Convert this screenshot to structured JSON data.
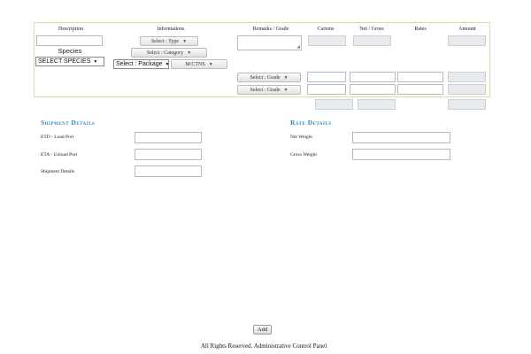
{
  "items_table": {
    "headers": {
      "description": "Description",
      "informations": "Informations",
      "remarks": "Remarks / Grade",
      "cartons": "Cartons",
      "net_gross": "Net / Gross",
      "rates": "Rates",
      "amount": "Amount"
    },
    "species_label": "Species",
    "species_select": "SELECT SPECIES",
    "type_select": "Select : Type",
    "category_select": "Select : Category",
    "package_select": "Select : Package",
    "unit_select": "M/CTNS",
    "grade_selects": [
      "Select : Grade",
      "Select : Grade"
    ]
  },
  "shipment_details": {
    "title": "Shipment Details",
    "fields": {
      "etd": "ETD - Load Port",
      "eta": "ETA - Unload Port",
      "details": "Shipment Details"
    }
  },
  "rate_details": {
    "title": "Rate Details",
    "fields": {
      "net_weight": "Net Weight",
      "gross_weight": "Gross Weight"
    }
  },
  "add_button": "Add",
  "footer": "All Rights Reserved. Administrative Control Panel"
}
